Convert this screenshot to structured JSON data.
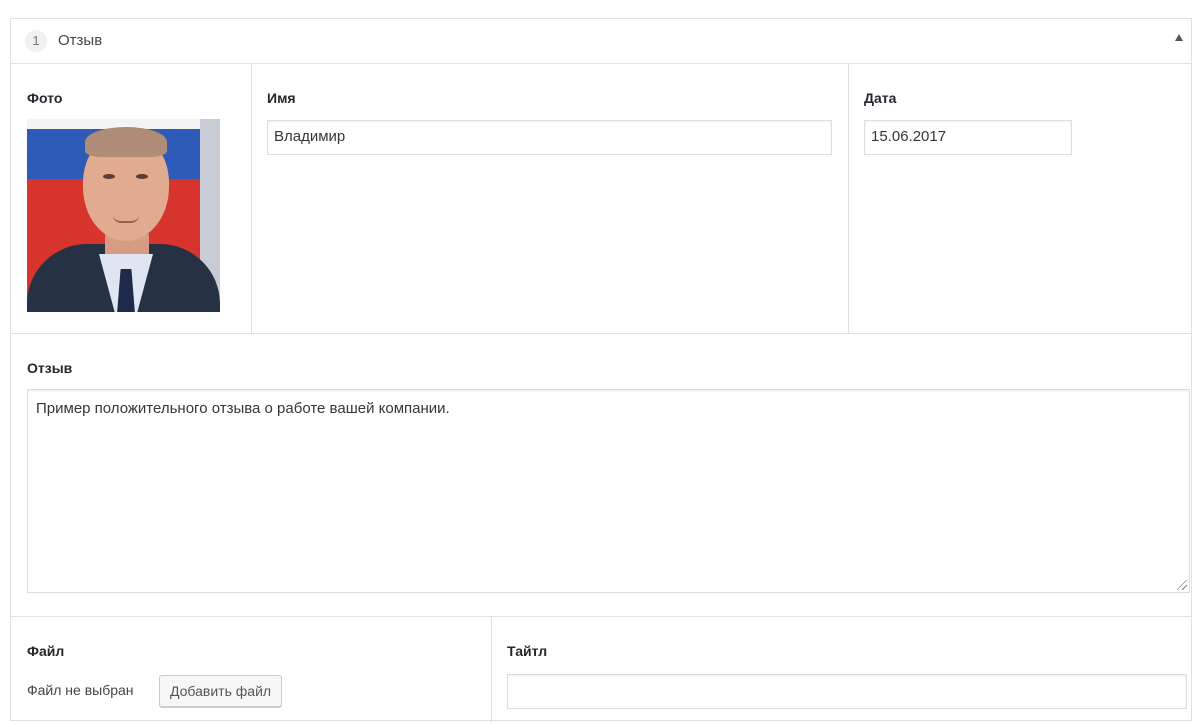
{
  "row": {
    "index": "1",
    "title": "Отзыв"
  },
  "photo": {
    "label": "Фото",
    "alt": "Фото"
  },
  "name": {
    "label": "Имя",
    "value": "Владимир"
  },
  "date": {
    "label": "Дата",
    "value": "15.06.2017"
  },
  "review": {
    "label": "Отзыв",
    "value": "Пример положительного отзыва о работе вашей компании."
  },
  "file": {
    "label": "Файл",
    "status": "Файл не выбран",
    "button": "Добавить файл"
  },
  "title_field": {
    "label": "Тайтл",
    "value": ""
  },
  "icons": {
    "collapse": "collapse-arrow-icon"
  }
}
